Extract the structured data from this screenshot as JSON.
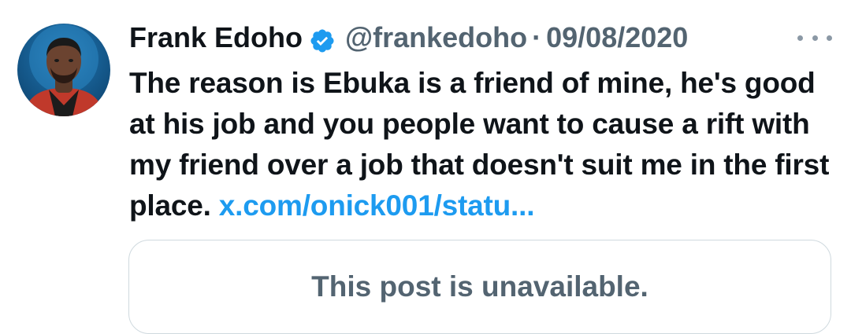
{
  "tweet": {
    "author_name": "Frank Edoho",
    "handle": "@frankedoho",
    "separator": "·",
    "date": "09/08/2020",
    "body_text": "The reason is Ebuka is a friend of mine, he's good at his job and you people want to cause a rift with my friend over a job that doesn't suit me in the first place. ",
    "link_text": "x.com/onick001/statu...",
    "quoted_post_text": "This post is unavailable."
  },
  "icons": {
    "verified": "verified-badge-icon",
    "more": "more-options-icon",
    "avatar": "avatar"
  },
  "colors": {
    "text": "#0f1419",
    "secondary": "#536471",
    "link": "#1d9bf0",
    "verified": "#1d9bf0",
    "border": "#cfd9de"
  }
}
